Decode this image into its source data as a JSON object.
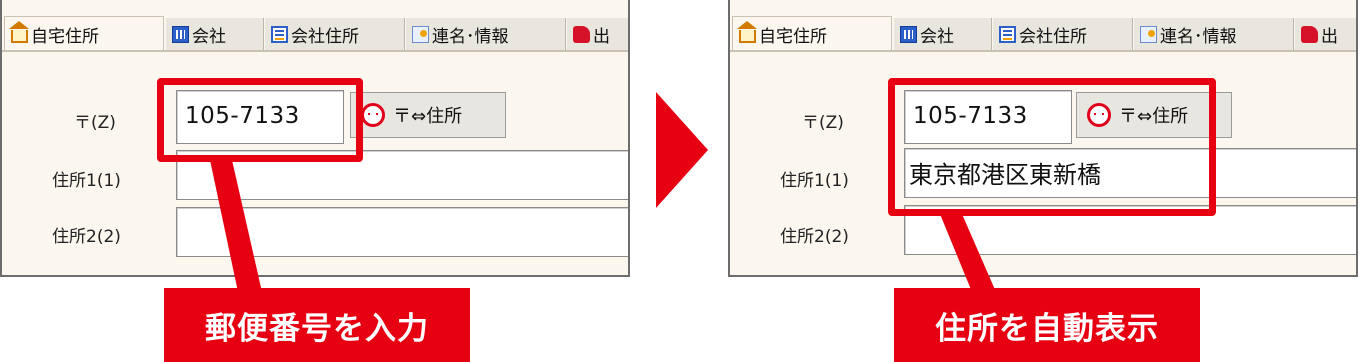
{
  "tabs": [
    {
      "label": "自宅住所",
      "icon": "house-icon"
    },
    {
      "label": "会社",
      "icon": "company-icon"
    },
    {
      "label": "会社住所",
      "icon": "address-icon"
    },
    {
      "label": "連名･情報",
      "icon": "contacts-icon"
    },
    {
      "label": "出",
      "icon": "other-icon"
    }
  ],
  "form": {
    "zip_label": "〒(Z)",
    "address1_label": "住所1(1)",
    "address2_label": "住所2(2)",
    "zip_value": "105-7133",
    "convert_button_label": "〒⇔住所"
  },
  "before": {
    "address1_value": ""
  },
  "after": {
    "address1_value": "東京都港区東新橋"
  },
  "callouts": {
    "left": "郵便番号を入力",
    "right": "住所を自動表示"
  },
  "colors": {
    "highlight": "#e60012",
    "panel_bg": "#fbf7ee"
  }
}
